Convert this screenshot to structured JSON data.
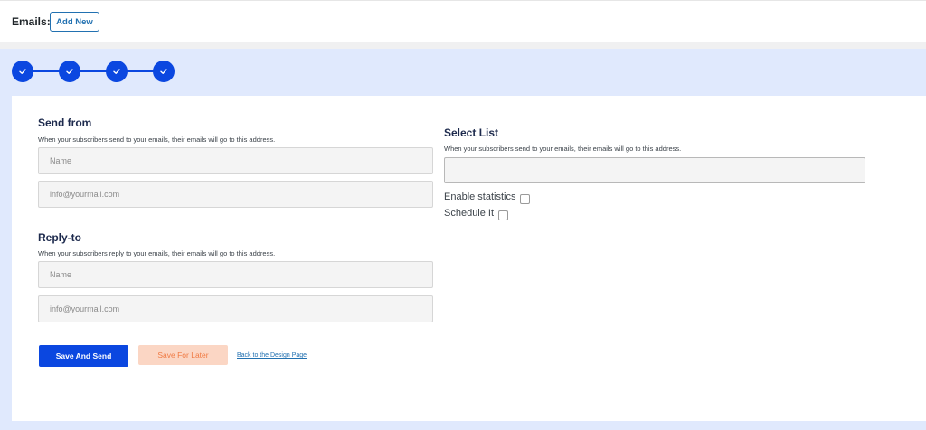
{
  "header": {
    "title": "Emails:",
    "add_new_label": "Add New"
  },
  "stepper": {
    "steps": [
      {
        "state": "complete",
        "icon": "check-icon"
      },
      {
        "state": "complete",
        "icon": "check-icon"
      },
      {
        "state": "complete",
        "icon": "check-icon"
      },
      {
        "state": "complete",
        "icon": "check-icon"
      }
    ],
    "accent_color": "#0b47e0"
  },
  "send_from": {
    "title": "Send from",
    "description": "When your subscribers send to your emails, their emails will go to this address.",
    "name_placeholder": "Name",
    "email_placeholder": "info@yourmail.com",
    "name_value": "",
    "email_value": ""
  },
  "reply_to": {
    "title": "Reply-to",
    "description": "When your subscribers reply to your emails, their emails will go to this address.",
    "name_placeholder": "Name",
    "email_placeholder": "info@yourmail.com",
    "name_value": "",
    "email_value": ""
  },
  "select_list": {
    "title": "Select List",
    "description": "When your subscribers send to your emails, their emails will go to this address.",
    "selected_value": ""
  },
  "options": {
    "enable_statistics_label": "Enable statistics",
    "enable_statistics_checked": false,
    "schedule_label": "Schedule It",
    "schedule_checked": false
  },
  "actions": {
    "save_and_send_label": "Save And Send",
    "save_for_later_label": "Save For Later",
    "back_link_label": "Back to the Design Page"
  },
  "colors": {
    "primary": "#0b47e0",
    "secondary_bg": "#fbd6c4",
    "secondary_text": "#f07a43",
    "panel_bg": "#e0e9fd"
  }
}
